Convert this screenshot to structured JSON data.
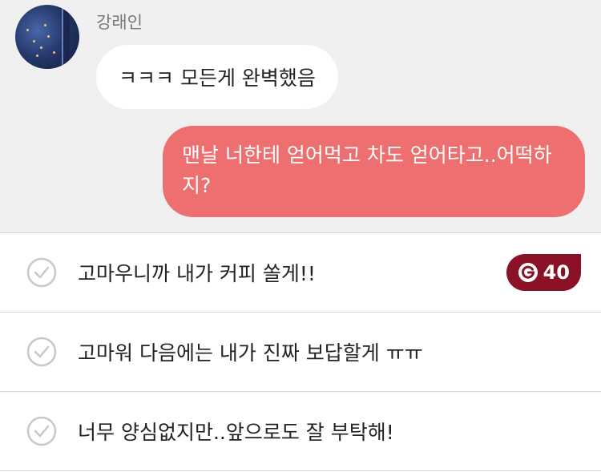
{
  "chat": {
    "sender_name": "강래인",
    "incoming_message": "ㅋㅋㅋ 모든게 완벽했음",
    "outgoing_message": "맨날 너한테 얻어먹고 차도 얻어타고..어떡하지?"
  },
  "options": [
    {
      "text": "고마우니까 내가 커피 쏠게!!",
      "cost": "40",
      "cost_icon": "coin-g-icon"
    },
    {
      "text": "고마워 다음에는 내가 진짜 보답할게 ㅠㅠ"
    },
    {
      "text": "너무 양심없지만..앞으로도 잘 부탁해!"
    }
  ],
  "colors": {
    "chat_background": "#f0f0f0",
    "outgoing_bubble": "#ed6f6f",
    "incoming_bubble": "#ffffff",
    "cost_badge": "#8a1126",
    "check_icon": "#c8c8c8"
  }
}
